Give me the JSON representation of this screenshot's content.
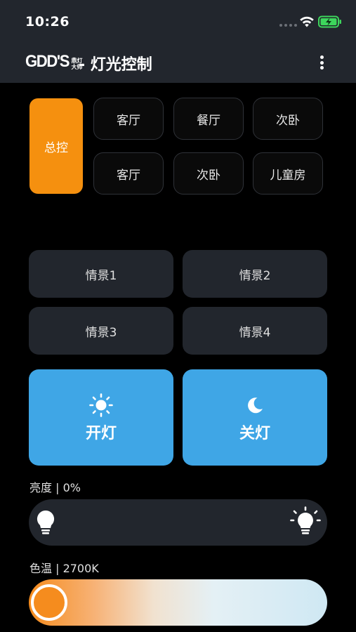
{
  "status": {
    "time": "10:26"
  },
  "header": {
    "logo_main": "GDD'S",
    "logo_sub_top": "鼎灯",
    "logo_sub_bottom": "大师",
    "title": "- 灯光控制"
  },
  "rooms": {
    "master": "总控",
    "items": [
      "客厅",
      "餐厅",
      "次卧",
      "客厅",
      "次卧",
      "儿童房"
    ]
  },
  "scenes": [
    "情景1",
    "情景2",
    "情景3",
    "情景4"
  ],
  "power": {
    "on_label": "开灯",
    "off_label": "关灯"
  },
  "brightness": {
    "label": "亮度 | 0%",
    "value_percent": 0
  },
  "color_temp": {
    "label": "色温 | 2700K",
    "value_k": 2700,
    "level_fraction": 0
  },
  "colors": {
    "accent_orange": "#f5900f",
    "accent_blue": "#3fa6e6",
    "card_bg": "#22262d"
  }
}
